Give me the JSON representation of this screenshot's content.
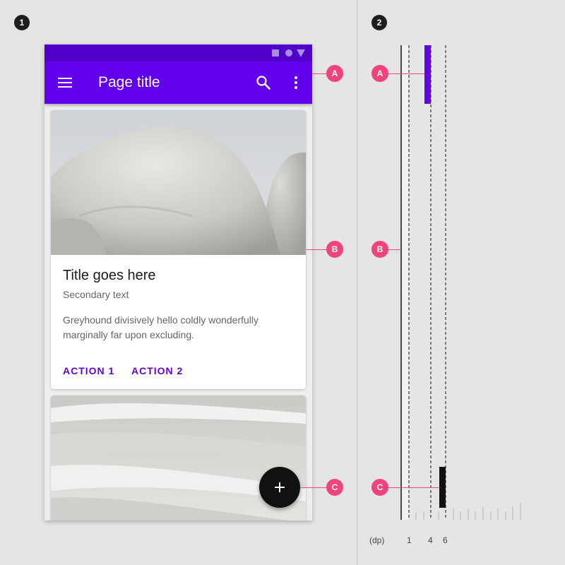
{
  "panels": [
    "1",
    "2"
  ],
  "app_bar": {
    "title": "Page title"
  },
  "card": {
    "title": "Title goes here",
    "secondary": "Secondary text",
    "body": "Greyhound divisively hello coldly wonderfully marginally far upon excluding.",
    "actions": [
      "ACTION 1",
      "ACTION 2"
    ]
  },
  "callouts": [
    "A",
    "B",
    "C"
  ],
  "elevation_diagram": {
    "unit_label": "(dp)",
    "ticks": [
      "1",
      "4",
      "6"
    ]
  },
  "colors": {
    "primary": "#6200ee",
    "primary_dark": "#5100c9",
    "callout": "#f2437a",
    "fab": "#111111"
  },
  "icons": [
    "menu-icon",
    "search-icon",
    "more-vert-icon",
    "add-icon",
    "square-icon",
    "circle-icon",
    "triangle-icon"
  ]
}
